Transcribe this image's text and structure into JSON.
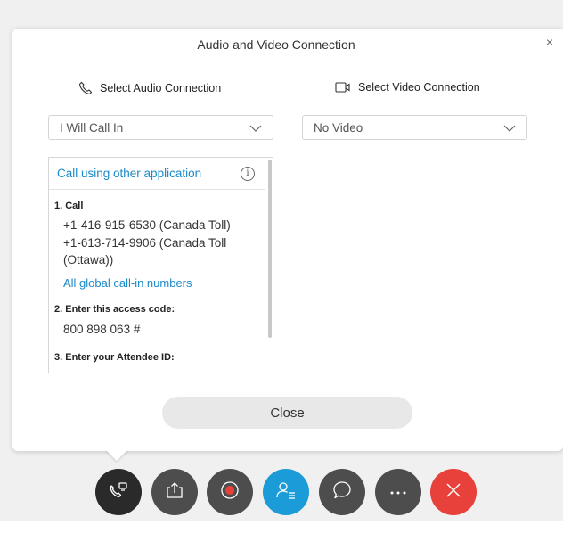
{
  "dialog": {
    "title": "Audio and Video Connection",
    "close_glyph": "×",
    "audio": {
      "header_label": "Select Audio Connection",
      "header_icon": "phone-icon",
      "selected": "I Will Call In"
    },
    "video": {
      "header_label": "Select Video Connection",
      "header_icon": "video-camera-icon",
      "selected": "No Video"
    },
    "callin_panel": {
      "link": "Call using other application",
      "info_icon": "info-icon",
      "step1_label": "1. Call",
      "numbers": [
        "+1-416-915-6530 (Canada Toll)",
        "+1-613-714-9906 (Canada Toll (Ottawa))"
      ],
      "global_link": "All global call-in numbers",
      "step2_label": "2. Enter this access code:",
      "access_code": "800 898 063 #",
      "step3_label": "3. Enter your Attendee ID:"
    },
    "close_button": "Close"
  },
  "toolbar": {
    "buttons": [
      {
        "name": "audio-connection",
        "icon": "phone-settings-icon",
        "color": "#2a2a2a"
      },
      {
        "name": "share",
        "icon": "share-icon",
        "color": "#4d4d4d"
      },
      {
        "name": "record",
        "icon": "record-icon",
        "color": "#4d4d4d"
      },
      {
        "name": "participants",
        "icon": "participants-icon",
        "color": "#1b9bd8"
      },
      {
        "name": "chat",
        "icon": "chat-icon",
        "color": "#4d4d4d"
      },
      {
        "name": "more",
        "icon": "more-icon",
        "color": "#4d4d4d"
      },
      {
        "name": "leave",
        "icon": "close-icon",
        "color": "#e8403a"
      }
    ]
  },
  "colors": {
    "link": "#1a8ac8",
    "accent_blue": "#1b9bd8",
    "leave_red": "#e8403a"
  }
}
